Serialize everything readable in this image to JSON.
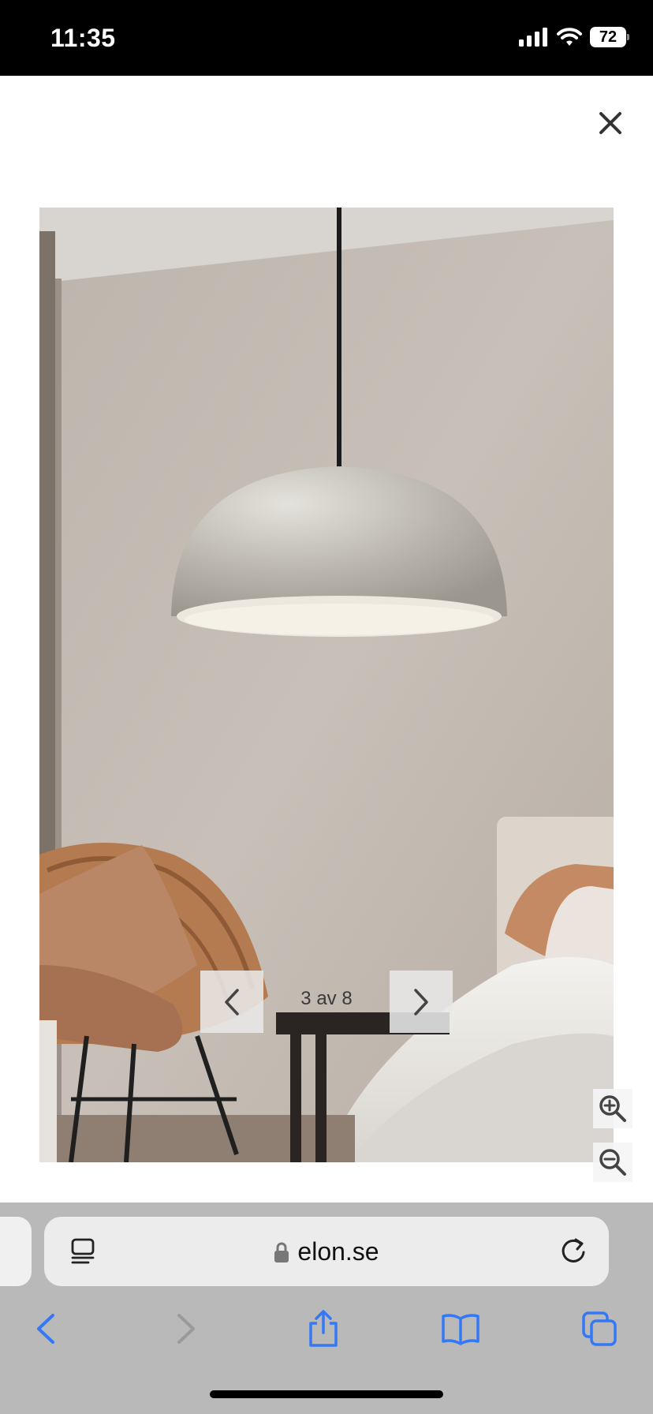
{
  "status_bar": {
    "time": "11:35",
    "battery": "72"
  },
  "gallery": {
    "counter": "3 av 8"
  },
  "browser": {
    "url": "elon.se"
  },
  "colors": {
    "accent": "#3478f6",
    "disabled": "#9a9a9a",
    "toolbar_bg": "#b9b9b9"
  },
  "icons": {
    "close": "close-icon",
    "prev": "chevron-left-icon",
    "next": "chevron-right-icon",
    "zoom_in": "zoom-in-icon",
    "zoom_out": "zoom-out-icon",
    "reader": "reader-mode-icon",
    "lock": "lock-icon",
    "reload": "reload-icon",
    "back": "back-icon",
    "forward": "forward-icon",
    "share": "share-icon",
    "bookmarks": "bookmarks-icon",
    "tabs": "tabs-icon"
  }
}
